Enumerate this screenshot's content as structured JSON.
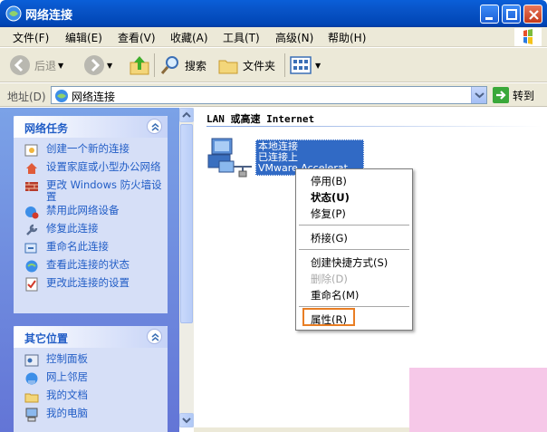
{
  "window": {
    "title": "网络连接"
  },
  "menu": [
    "文件(F)",
    "编辑(E)",
    "查看(V)",
    "收藏(A)",
    "工具(T)",
    "高级(N)",
    "帮助(H)"
  ],
  "toolbar": {
    "back": "后退",
    "search": "搜索",
    "folders": "文件夹"
  },
  "address": {
    "label": "地址(D)",
    "value": "网络连接",
    "go": "转到"
  },
  "tasks": {
    "title": "网络任务",
    "items": [
      "创建一个新的连接",
      "设置家庭或小型办公网络",
      "更改 Windows 防火墙设置",
      "禁用此网络设备",
      "修复此连接",
      "重命名此连接",
      "查看此连接的状态",
      "更改此连接的设置"
    ]
  },
  "other_places": {
    "title": "其它位置",
    "items": [
      "控制面板",
      "网上邻居",
      "我的文档",
      "我的电脑"
    ]
  },
  "content": {
    "group": "LAN 或高速 Internet",
    "connection": {
      "name": "本地连接",
      "status": "已连接上",
      "device": "VMware Accelerat"
    }
  },
  "context_menu": [
    "停用(B)",
    "状态(U)",
    "修复(P)",
    "桥接(G)",
    "创建快捷方式(S)",
    "删除(D)",
    "重命名(M)",
    "属性(R)"
  ]
}
